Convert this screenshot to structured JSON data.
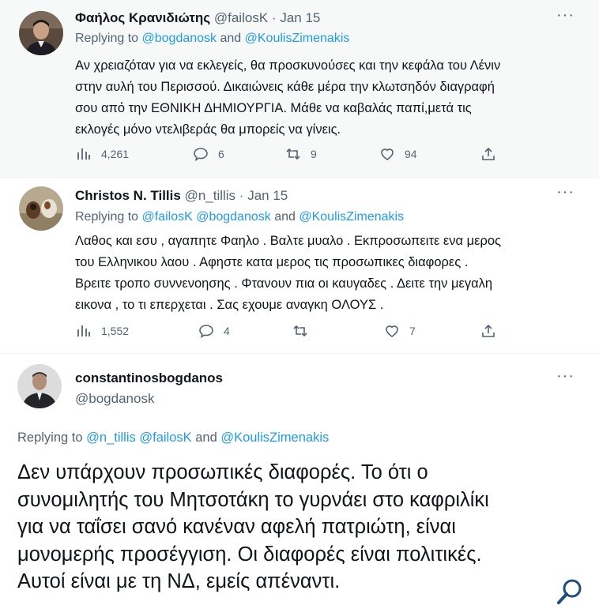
{
  "tweets": [
    {
      "display_name": "Φαήλος Κρανιδιώτης",
      "handle": "@failosK",
      "separator": "·",
      "date": "Jan 15",
      "replying_label": "Replying to",
      "mentions": [
        "@bogdanosk",
        "@KoulisZimenakis"
      ],
      "joiners": [
        "and"
      ],
      "body_lines": [
        "Αν χρειαζόταν για να εκλεγείς, θα προσκυνούσες και την κεφάλα του Λένιν",
        "στην αυλή του Περισσού. Δικαιώνεις κάθε μέρα την κλωτσηδόν διαγραφή",
        "σου από την ΕΘΝΙΚΗ ΔΗΜΙΟΥΡΓΙΑ. Μάθε να καβαλάς παπί,μετά τις",
        "εκλογές μόνο ντελιβεράς θα μπορείς να γίνεις."
      ],
      "views": "4,261",
      "replies": "6",
      "retweets": "9",
      "likes": "94"
    },
    {
      "display_name": "Christos N. Tillis",
      "handle": "@n_tillis",
      "separator": "·",
      "date": "Jan 15",
      "replying_label": "Replying to",
      "mentions": [
        "@failosK",
        "@bogdanosk",
        "@KoulisZimenakis"
      ],
      "joiners": [
        "and"
      ],
      "body_lines": [
        "Λαθος και εσυ , αγαπητε Φαηλο . Βαλτε μυαλο . Εκπροσωπειτε ενα μερος",
        "του Ελληνικου λαου . Αφηστε κατα μερος τις προσωπικες διαφορες .",
        "Βρειτε τροπο συννενοησης . Φτανουν πια οι καυγαδες . Δειτε την μεγαλη",
        "εικονα , το τι επερχεται . Σας εχουμε αναγκη ΟΛΟΥΣ ."
      ],
      "views": "1,552",
      "replies": "4",
      "retweets": "",
      "likes": "7"
    },
    {
      "display_name": "constantinosbogdanos",
      "handle": "@bogdanosk",
      "replying_label": "Replying to",
      "mentions": [
        "@n_tillis",
        "@failosK",
        "@KoulisZimenakis"
      ],
      "joiners": [
        "and"
      ],
      "body_lines": [
        "Δεν υπάρχουν προσωπικές διαφορές. Το ότι ο",
        "συνομιλητής του Μητσοτάκη το γυρνάει στο καφριλίκι",
        "για να ταΐσει σανό κανέναν αφελή πατριώτη, είναι",
        "μονομερής προσέγγιση. Οι διαφορές είναι πολιτικές.",
        "Αυτοί είναι με τη ΝΔ, εμείς απέναντι."
      ]
    }
  ],
  "colors": {
    "link": "#1d9bf0",
    "muted": "#536471",
    "text": "#0f1419",
    "selected_bg": "#f7f9f9"
  },
  "icons": [
    "more-icon",
    "views-icon",
    "reply-icon",
    "retweet-icon",
    "like-icon",
    "share-icon",
    "zoom-icon"
  ]
}
